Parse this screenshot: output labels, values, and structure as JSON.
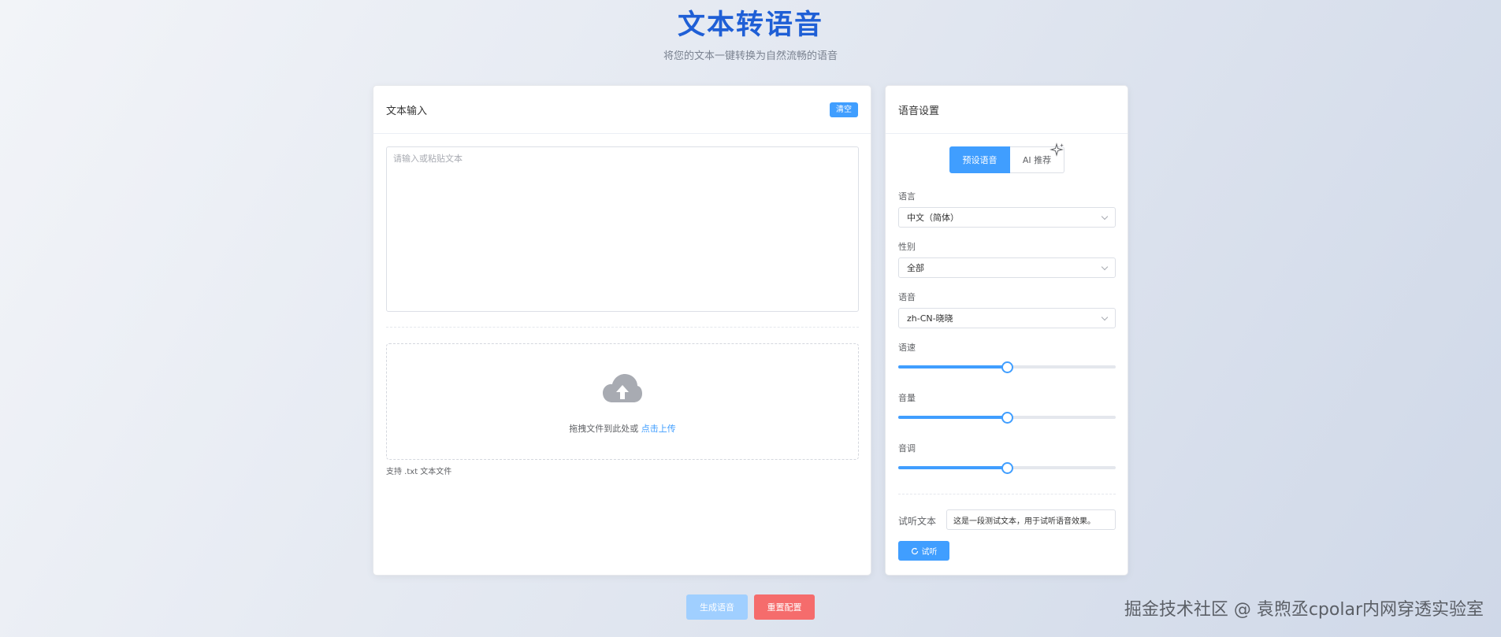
{
  "header": {
    "title": "文本转语音",
    "subtitle": "将您的文本一键转换为自然流畅的语音"
  },
  "text_input": {
    "title": "文本输入",
    "clear_label": "清空",
    "placeholder": "请输入或粘贴文本",
    "upload_prompt": "拖拽文件到此处或",
    "upload_link": "点击上传",
    "upload_tip": "支持 .txt 文本文件"
  },
  "voice_settings": {
    "title": "语音设置",
    "tabs": [
      {
        "label": "预设语音",
        "active": true
      },
      {
        "label": "AI 推荐",
        "active": false
      }
    ],
    "language": {
      "label": "语言",
      "value": "中文（简体）"
    },
    "gender": {
      "label": "性别",
      "value": "全部"
    },
    "voice": {
      "label": "语音",
      "value": "zh-CN-晓晓"
    },
    "rate": {
      "label": "语速",
      "fraction": 0.5
    },
    "volume": {
      "label": "音量",
      "fraction": 0.5
    },
    "pitch": {
      "label": "音调",
      "fraction": 0.5
    },
    "preview_label": "试听文本",
    "preview_text": "这是一段测试文本，用于试听语音效果。",
    "listen_label": "试听"
  },
  "actions": {
    "generate_label": "生成语音",
    "reset_label": "重置配置"
  },
  "watermark": "掘金技术社区 @ 袁煦丞cpolar内网穿透实验室",
  "colors": {
    "primary": "#409eff",
    "title": "#1f5fd6",
    "danger": "#f56c6c",
    "disabled_primary": "#a0cfff"
  }
}
